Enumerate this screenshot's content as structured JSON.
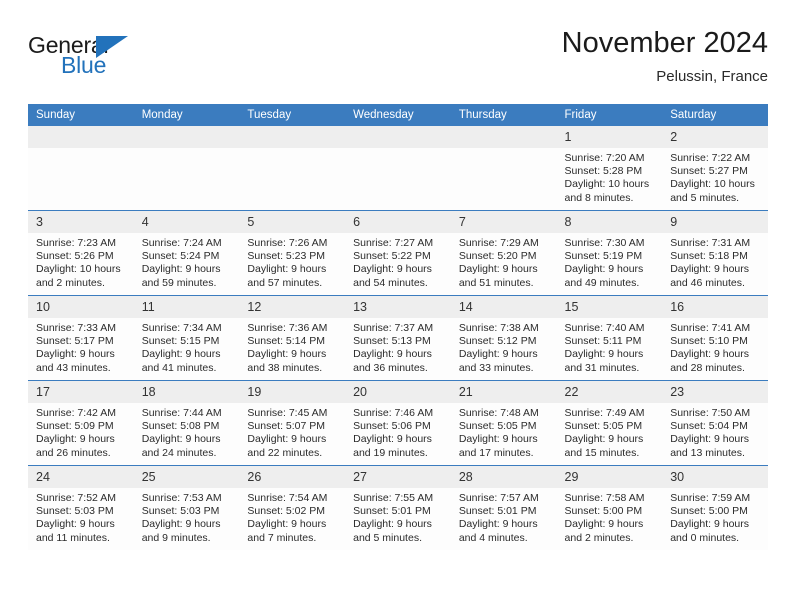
{
  "logo": {
    "word1": "General",
    "word2": "Blue",
    "triangle_color": "#2272bb",
    "icon": "triangle-flag-icon"
  },
  "header": {
    "title": "November 2024",
    "subtitle": "Pelussin, France"
  },
  "colors": {
    "header_blue": "#3b7cbf",
    "daynum_gray": "#eeeeee",
    "cell_bg": "#fdfdfd",
    "text": "#2b2b2b"
  },
  "weekdays": [
    "Sunday",
    "Monday",
    "Tuesday",
    "Wednesday",
    "Thursday",
    "Friday",
    "Saturday"
  ],
  "labels": {
    "sunrise": "Sunrise:",
    "sunset": "Sunset:",
    "daylight": "Daylight:"
  },
  "weeks": [
    [
      {
        "day": "",
        "empty": true
      },
      {
        "day": "",
        "empty": true
      },
      {
        "day": "",
        "empty": true
      },
      {
        "day": "",
        "empty": true
      },
      {
        "day": "",
        "empty": true
      },
      {
        "day": "1",
        "sunrise": "Sunrise: 7:20 AM",
        "sunset": "Sunset: 5:28 PM",
        "daylight1": "Daylight: 10 hours",
        "daylight2": "and 8 minutes."
      },
      {
        "day": "2",
        "sunrise": "Sunrise: 7:22 AM",
        "sunset": "Sunset: 5:27 PM",
        "daylight1": "Daylight: 10 hours",
        "daylight2": "and 5 minutes."
      }
    ],
    [
      {
        "day": "3",
        "sunrise": "Sunrise: 7:23 AM",
        "sunset": "Sunset: 5:26 PM",
        "daylight1": "Daylight: 10 hours",
        "daylight2": "and 2 minutes."
      },
      {
        "day": "4",
        "sunrise": "Sunrise: 7:24 AM",
        "sunset": "Sunset: 5:24 PM",
        "daylight1": "Daylight: 9 hours",
        "daylight2": "and 59 minutes."
      },
      {
        "day": "5",
        "sunrise": "Sunrise: 7:26 AM",
        "sunset": "Sunset: 5:23 PM",
        "daylight1": "Daylight: 9 hours",
        "daylight2": "and 57 minutes."
      },
      {
        "day": "6",
        "sunrise": "Sunrise: 7:27 AM",
        "sunset": "Sunset: 5:22 PM",
        "daylight1": "Daylight: 9 hours",
        "daylight2": "and 54 minutes."
      },
      {
        "day": "7",
        "sunrise": "Sunrise: 7:29 AM",
        "sunset": "Sunset: 5:20 PM",
        "daylight1": "Daylight: 9 hours",
        "daylight2": "and 51 minutes."
      },
      {
        "day": "8",
        "sunrise": "Sunrise: 7:30 AM",
        "sunset": "Sunset: 5:19 PM",
        "daylight1": "Daylight: 9 hours",
        "daylight2": "and 49 minutes."
      },
      {
        "day": "9",
        "sunrise": "Sunrise: 7:31 AM",
        "sunset": "Sunset: 5:18 PM",
        "daylight1": "Daylight: 9 hours",
        "daylight2": "and 46 minutes."
      }
    ],
    [
      {
        "day": "10",
        "sunrise": "Sunrise: 7:33 AM",
        "sunset": "Sunset: 5:17 PM",
        "daylight1": "Daylight: 9 hours",
        "daylight2": "and 43 minutes."
      },
      {
        "day": "11",
        "sunrise": "Sunrise: 7:34 AM",
        "sunset": "Sunset: 5:15 PM",
        "daylight1": "Daylight: 9 hours",
        "daylight2": "and 41 minutes."
      },
      {
        "day": "12",
        "sunrise": "Sunrise: 7:36 AM",
        "sunset": "Sunset: 5:14 PM",
        "daylight1": "Daylight: 9 hours",
        "daylight2": "and 38 minutes."
      },
      {
        "day": "13",
        "sunrise": "Sunrise: 7:37 AM",
        "sunset": "Sunset: 5:13 PM",
        "daylight1": "Daylight: 9 hours",
        "daylight2": "and 36 minutes."
      },
      {
        "day": "14",
        "sunrise": "Sunrise: 7:38 AM",
        "sunset": "Sunset: 5:12 PM",
        "daylight1": "Daylight: 9 hours",
        "daylight2": "and 33 minutes."
      },
      {
        "day": "15",
        "sunrise": "Sunrise: 7:40 AM",
        "sunset": "Sunset: 5:11 PM",
        "daylight1": "Daylight: 9 hours",
        "daylight2": "and 31 minutes."
      },
      {
        "day": "16",
        "sunrise": "Sunrise: 7:41 AM",
        "sunset": "Sunset: 5:10 PM",
        "daylight1": "Daylight: 9 hours",
        "daylight2": "and 28 minutes."
      }
    ],
    [
      {
        "day": "17",
        "sunrise": "Sunrise: 7:42 AM",
        "sunset": "Sunset: 5:09 PM",
        "daylight1": "Daylight: 9 hours",
        "daylight2": "and 26 minutes."
      },
      {
        "day": "18",
        "sunrise": "Sunrise: 7:44 AM",
        "sunset": "Sunset: 5:08 PM",
        "daylight1": "Daylight: 9 hours",
        "daylight2": "and 24 minutes."
      },
      {
        "day": "19",
        "sunrise": "Sunrise: 7:45 AM",
        "sunset": "Sunset: 5:07 PM",
        "daylight1": "Daylight: 9 hours",
        "daylight2": "and 22 minutes."
      },
      {
        "day": "20",
        "sunrise": "Sunrise: 7:46 AM",
        "sunset": "Sunset: 5:06 PM",
        "daylight1": "Daylight: 9 hours",
        "daylight2": "and 19 minutes."
      },
      {
        "day": "21",
        "sunrise": "Sunrise: 7:48 AM",
        "sunset": "Sunset: 5:05 PM",
        "daylight1": "Daylight: 9 hours",
        "daylight2": "and 17 minutes."
      },
      {
        "day": "22",
        "sunrise": "Sunrise: 7:49 AM",
        "sunset": "Sunset: 5:05 PM",
        "daylight1": "Daylight: 9 hours",
        "daylight2": "and 15 minutes."
      },
      {
        "day": "23",
        "sunrise": "Sunrise: 7:50 AM",
        "sunset": "Sunset: 5:04 PM",
        "daylight1": "Daylight: 9 hours",
        "daylight2": "and 13 minutes."
      }
    ],
    [
      {
        "day": "24",
        "sunrise": "Sunrise: 7:52 AM",
        "sunset": "Sunset: 5:03 PM",
        "daylight1": "Daylight: 9 hours",
        "daylight2": "and 11 minutes."
      },
      {
        "day": "25",
        "sunrise": "Sunrise: 7:53 AM",
        "sunset": "Sunset: 5:03 PM",
        "daylight1": "Daylight: 9 hours",
        "daylight2": "and 9 minutes."
      },
      {
        "day": "26",
        "sunrise": "Sunrise: 7:54 AM",
        "sunset": "Sunset: 5:02 PM",
        "daylight1": "Daylight: 9 hours",
        "daylight2": "and 7 minutes."
      },
      {
        "day": "27",
        "sunrise": "Sunrise: 7:55 AM",
        "sunset": "Sunset: 5:01 PM",
        "daylight1": "Daylight: 9 hours",
        "daylight2": "and 5 minutes."
      },
      {
        "day": "28",
        "sunrise": "Sunrise: 7:57 AM",
        "sunset": "Sunset: 5:01 PM",
        "daylight1": "Daylight: 9 hours",
        "daylight2": "and 4 minutes."
      },
      {
        "day": "29",
        "sunrise": "Sunrise: 7:58 AM",
        "sunset": "Sunset: 5:00 PM",
        "daylight1": "Daylight: 9 hours",
        "daylight2": "and 2 minutes."
      },
      {
        "day": "30",
        "sunrise": "Sunrise: 7:59 AM",
        "sunset": "Sunset: 5:00 PM",
        "daylight1": "Daylight: 9 hours",
        "daylight2": "and 0 minutes."
      }
    ]
  ]
}
